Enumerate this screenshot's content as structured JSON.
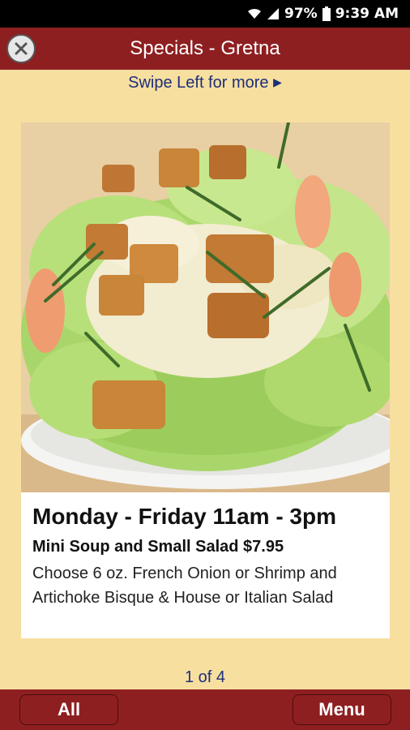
{
  "status_bar": {
    "battery": "97%",
    "time": "9:39 AM"
  },
  "header": {
    "title": "Specials - Gretna",
    "close_icon": "close-icon"
  },
  "swipe_hint": {
    "text": "Swipe Left for more",
    "arrow": "▶"
  },
  "special": {
    "image": "caesar-salad-photo",
    "title": "Monday - Friday 11am - 3pm",
    "subtitle": "Mini Soup and Small Salad $7.95",
    "description": "Choose 6 oz. French Onion or Shrimp and Artichoke Bisque & House or Italian Salad"
  },
  "pager": {
    "text": "1 of 4"
  },
  "bottom_bar": {
    "all_label": "All",
    "menu_label": "Menu"
  },
  "colors": {
    "brand": "#8e1f21",
    "background": "#f7dfa0",
    "link": "#1c2f7a"
  }
}
